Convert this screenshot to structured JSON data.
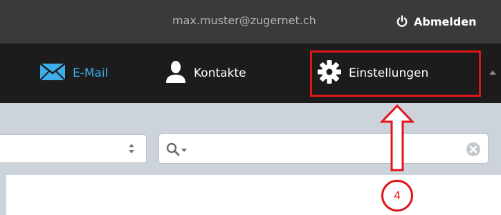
{
  "header": {
    "user_email": "max.muster@zugernet.ch",
    "logout_label": "Abmelden"
  },
  "nav": {
    "items": [
      {
        "label": "E-Mail",
        "icon": "envelope-icon",
        "active": true
      },
      {
        "label": "Kontakte",
        "icon": "person-icon",
        "active": false
      },
      {
        "label": "Einstellungen",
        "icon": "gear-icon",
        "active": false
      }
    ]
  },
  "toolbar": {
    "folder_select_value": "",
    "search_value": ""
  },
  "annotation": {
    "step_number": "4",
    "color": "#e0141b"
  },
  "colors": {
    "topbar": "#3a3a3a",
    "navbar": "#1c1c1c",
    "accent": "#3daee9",
    "content_bg": "#ccd3db"
  }
}
